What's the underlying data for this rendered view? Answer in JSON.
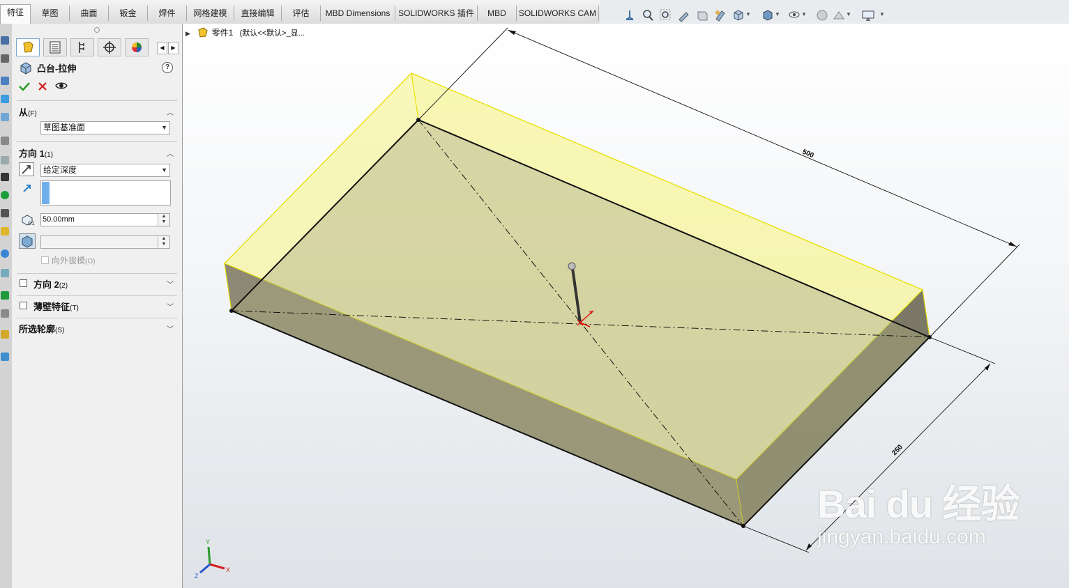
{
  "tabs": [
    "特征",
    "草图",
    "曲面",
    "钣金",
    "焊件",
    "网格建模",
    "直接编辑",
    "评估",
    "MBD Dimensions",
    "SOLIDWORKS 插件",
    "MBD",
    "SOLIDWORKS CAM"
  ],
  "panel": {
    "title": "凸台-拉伸",
    "help": "?",
    "from": {
      "label": "从",
      "accel": "(F)",
      "value": "草图基准面"
    },
    "direction1": {
      "label": "方向 1",
      "accel": "(1)",
      "end_condition": "给定深度",
      "depth": "50.00mm",
      "draft_label": "向外拔模",
      "draft_accel": "(O)"
    },
    "direction2": {
      "label": "方向 2",
      "accel": "(2)"
    },
    "thin": {
      "label": "薄壁特征",
      "accel": "(T)"
    },
    "contours": {
      "label": "所选轮廓",
      "accel": "(S)"
    }
  },
  "tree": {
    "part": "零件1",
    "config": "(默认<<默认>_显..."
  },
  "dimensions": {
    "length": "500",
    "width": "250"
  },
  "watermark": {
    "logo": "Bai du 经验",
    "url": "jingyan.baidu.com"
  },
  "triad": {
    "x": "X",
    "y": "Y",
    "z": "Z"
  },
  "colors": {
    "preview_face": "#f7f59a",
    "preview_edge": "#e6e000",
    "body_top": "#aead7b",
    "body_side": "#7a7663",
    "accept": "#1a9a1a",
    "cancel": "#d22020"
  }
}
